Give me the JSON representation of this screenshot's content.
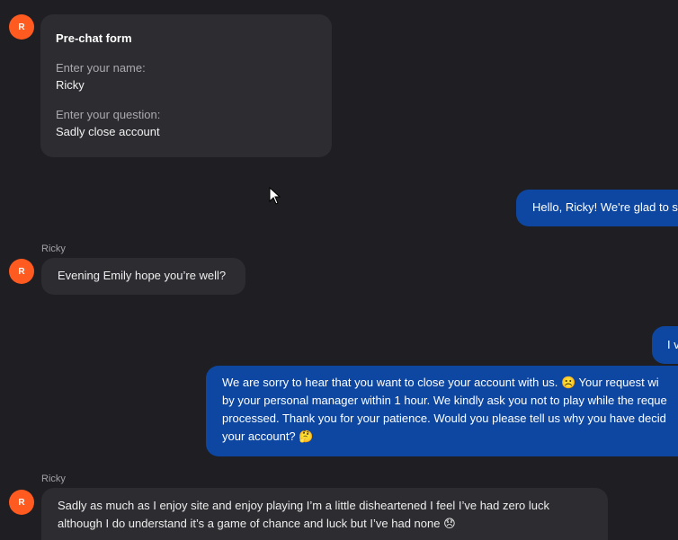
{
  "avatar_initial": "R",
  "prechat": {
    "title": "Pre-chat form",
    "name_label": "Enter your name:",
    "name_value": "Ricky",
    "question_label": "Enter your question:",
    "question_value": "Sadly close account"
  },
  "messages": [
    {
      "text": "Hello, Ricky! We're glad to s"
    },
    {
      "sender": "Ricky",
      "text": "Evening Emily hope you’re well?"
    },
    {
      "text": "I v"
    },
    {
      "lines": [
        "We are sorry to hear that you want to close your account with us. ☹️ Your request wi",
        "by your personal manager within 1 hour. We kindly ask you not to play while the reque",
        "processed. Thank you for your patience. Would you please tell us why you have decid",
        "your account? 🤔"
      ]
    },
    {
      "sender": "Ricky",
      "lines": [
        "Sadly as much as I enjoy site and enjoy playing I’m a little disheartened I feel I’ve had zero luck",
        "although I do understand it’s a game of chance and luck but I’ve had none 😞"
      ]
    }
  ],
  "colors": {
    "background": "#1f1f23",
    "incoming_bubble": "#2c2c31",
    "outgoing_bubble": "#0d47a1",
    "avatar": "#ff5a1f"
  }
}
